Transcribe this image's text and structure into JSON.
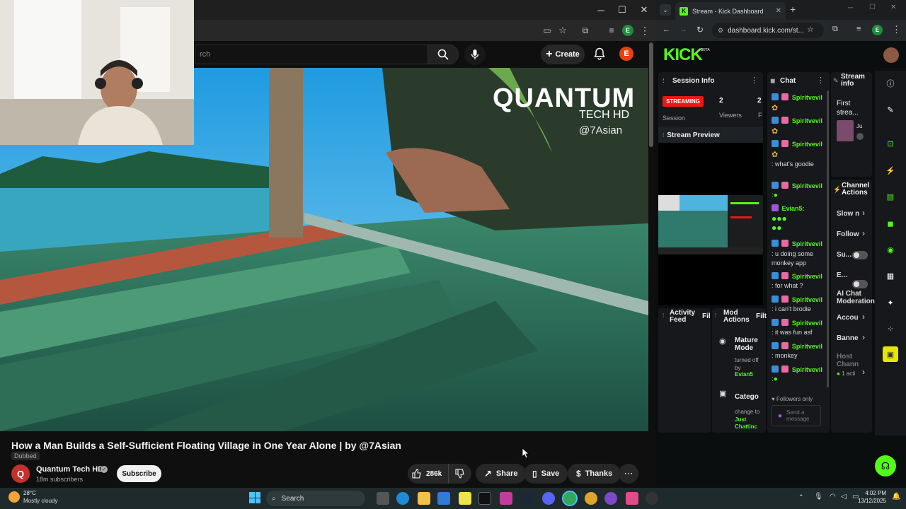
{
  "youtube": {
    "search_placeholder": "rch",
    "create_label": "Create",
    "avatar_letter": "E",
    "profile_letter": "E",
    "overlay_brand": "QUANTUM",
    "overlay_sub": "TECH HD",
    "overlay_handle": "@7Asian",
    "video_title": "How a Man Builds a Self-Sufficient Floating Village in One Year Alone | by @7Asian",
    "dubbed": "Dubbed",
    "channel_name": "Quantum Tech HD",
    "subscribers": "18m subscribers",
    "subscribe": "Subscribe",
    "likes": "286k",
    "share": "Share",
    "save": "Save",
    "thanks": "Thanks"
  },
  "kick": {
    "tab_title": "Stream - Kick Dashboard",
    "url": "dashboard.kick.com/st...",
    "profile_letter": "E",
    "logo": "KICK",
    "logo_sup": "BETA",
    "session_info": "Session Info",
    "streaming": "STREAMING",
    "stat1_value": "2",
    "stat1_label": "Session",
    "stat2_value": "2",
    "stat2_label": "Viewers",
    "stat3_value": "2",
    "stat3_label": "F",
    "stream_preview": "Stream Preview",
    "chat_title": "Chat",
    "chat": [
      {
        "user": "Spiritvevil",
        "msg": ""
      },
      {
        "user": "Spiritvevil",
        "msg": ""
      },
      {
        "user": "Spiritvevil",
        "msg": ""
      },
      {
        "user": "",
        "msg": ": what's goodie"
      },
      {
        "user": "Spiritvevil",
        "msg": ""
      },
      {
        "user": "Evian5:",
        "msg": ""
      },
      {
        "user": "Spiritvevil",
        "msg": ": u doing some monkey app"
      },
      {
        "user": "Spiritvevil",
        "msg": ": for what ?"
      },
      {
        "user": "Spiritvevil",
        "msg": ": i can't brodie"
      },
      {
        "user": "Spiritvevil",
        "msg": ": it was fun asf"
      },
      {
        "user": "Spiritvevil",
        "msg": ": monkey"
      },
      {
        "user": "Spiritvevil",
        "msg": ""
      }
    ],
    "followers_only": "Followers only",
    "send_placeholder": "Send a message",
    "stream_info": "Stream info",
    "stream_info_title": "First strea...",
    "stream_info_user": "Ju",
    "channel_actions": "Channel Actions",
    "actions": [
      "Slow n",
      "Follow",
      "Su...",
      "E...",
      "AI Chat Moderation",
      "Accou",
      "Banne",
      "Host Chann"
    ],
    "host_sub": "1 acti",
    "activity_feed": "Activity Feed",
    "activity_filter": "Fil",
    "mod_actions": "Mod Actions",
    "mod_filter": "Filt",
    "mature_title": "Mature Mode",
    "mature_desc": "turned off by",
    "mature_user": "Evian5",
    "category_title": "Catego",
    "category_desc": "change to",
    "category_value": "Just Chattinc"
  },
  "taskbar": {
    "temp": "28°C",
    "weather": "Mostly cloudy",
    "search": "Search",
    "time": "4:02 PM",
    "date": "13/12/2025"
  },
  "colors": {
    "kick_green": "#53fc18",
    "yt_red": "#ff0000",
    "streaming_red": "#e91916"
  }
}
